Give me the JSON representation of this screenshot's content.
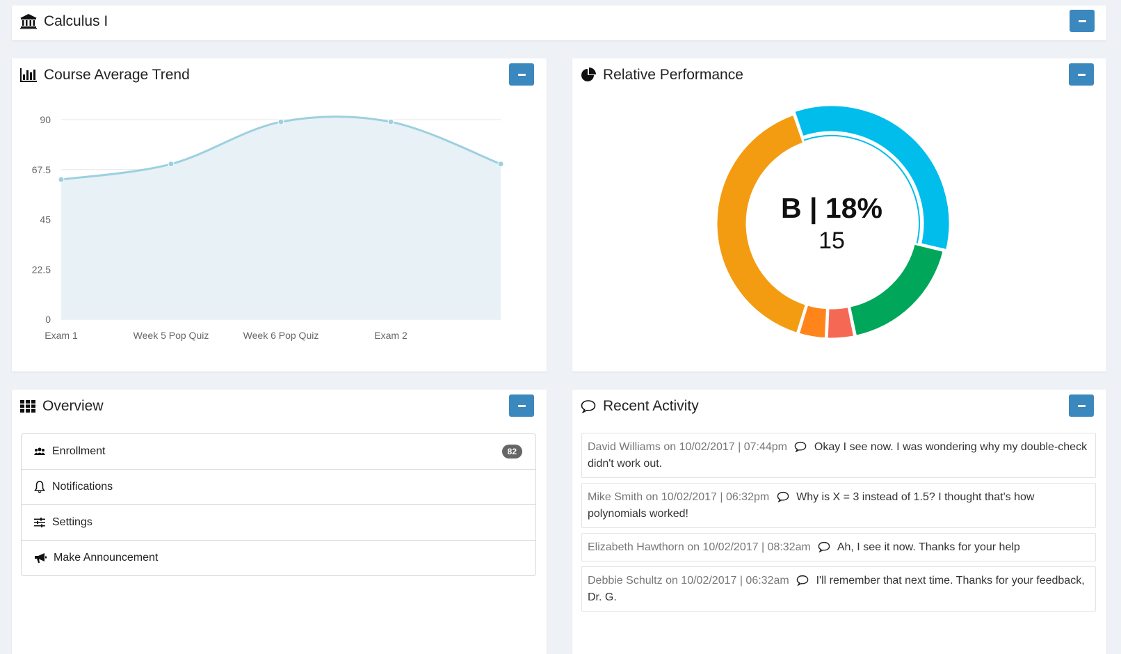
{
  "course": {
    "title": "Calculus I"
  },
  "trend_panel": {
    "title": "Course Average Trend"
  },
  "performance_panel": {
    "title": "Relative Performance",
    "center_label": "B | 18%",
    "center_value": "15"
  },
  "overview_panel": {
    "title": "Overview",
    "items": [
      {
        "label": "Enrollment",
        "icon": "users-icon",
        "badge": "82"
      },
      {
        "label": "Notifications",
        "icon": "bell-icon"
      },
      {
        "label": "Settings",
        "icon": "sliders-icon"
      },
      {
        "label": "Make Announcement",
        "icon": "megaphone-icon"
      }
    ]
  },
  "activity_panel": {
    "title": "Recent Activity",
    "items": [
      {
        "meta": "David Williams on 10/02/2017 | 07:44pm",
        "message": "Okay I see now. I was wondering why my double-check didn't work out."
      },
      {
        "meta": "Mike Smith on 10/02/2017 | 06:32pm",
        "message": "Why is X = 3 instead of 1.5? I thought that's how polynomials worked!"
      },
      {
        "meta": "Elizabeth Hawthorn on 10/02/2017 | 08:32am",
        "message": "Ah, I see it now. Thanks for your help"
      },
      {
        "meta": "Debbie Schultz on 10/02/2017 | 06:32am",
        "message": "I'll remember that next time. Thanks for your feedback, Dr. G."
      }
    ]
  },
  "colors": {
    "accent_button": "#3b88bf",
    "line": "#9dd0e0",
    "area_fill": "#e8f1f5",
    "donut_blue": "#00bdec",
    "donut_green": "#00a65a",
    "donut_red": "#f56954",
    "donut_orange": "#ff851b",
    "donut_yellow": "#f39c12"
  },
  "chart_data": [
    {
      "type": "area",
      "categories": [
        "Exam 1",
        "Week 5 Pop Quiz",
        "Week 6 Pop Quiz",
        "Exam 2",
        ""
      ],
      "values": [
        63,
        70,
        89,
        89,
        70
      ],
      "yticks": [
        "0",
        "22.5",
        "45",
        "67.5",
        "90"
      ],
      "ylim": [
        0,
        90
      ],
      "grid": true
    },
    {
      "type": "pie",
      "slices": [
        {
          "value": 34,
          "color": "#00bdec"
        },
        {
          "value": 18,
          "color": "#00a65a"
        },
        {
          "value": 4,
          "color": "#f56954"
        },
        {
          "value": 4,
          "color": "#ff851b"
        },
        {
          "value": 40,
          "color": "#f39c12"
        }
      ]
    }
  ]
}
